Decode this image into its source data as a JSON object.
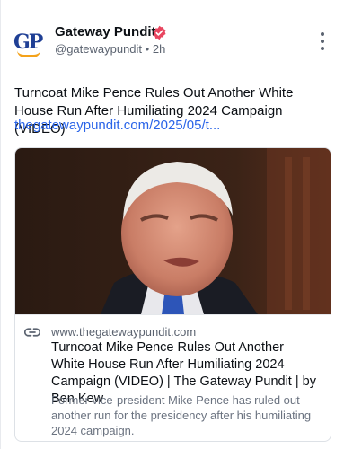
{
  "post": {
    "author_name": "Gateway Pundit",
    "avatar_text": "GP",
    "handle": "@gatewaypundit",
    "separator": "•",
    "time_ago": "2h",
    "text": "Turncoat Mike Pence Rules Out Another White House Run After Humiliating 2024 Campaign (VIDEO)",
    "link_text": "thegatewaypundit.com/2025/05/t...",
    "icons": {
      "verified": "verified-badge-icon",
      "more": "more-vertical-icon"
    }
  },
  "link_card": {
    "domain": "www.thegatewaypundit.com",
    "title": "Turncoat Mike Pence Rules Out Another White House Run After Humiliating 2024 Campaign (VIDEO) | The Gateway Pundit | by Ben Kew",
    "description": "Former vice-president Mike Pence has ruled out another run for the presidency after his humiliating 2024 campaign.",
    "icon": "link-icon"
  },
  "colors": {
    "link": "#2a64e8",
    "verified_badge": "#e8455f",
    "brand_blue": "#1f3f95",
    "brand_orange": "#f4a21a",
    "muted_text": "#5b6370"
  }
}
